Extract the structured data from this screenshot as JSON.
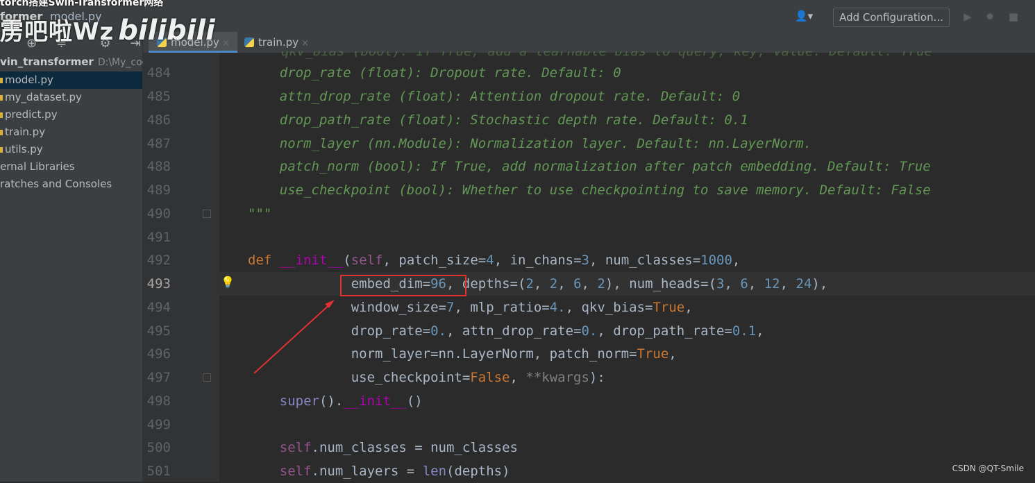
{
  "overlay": {
    "video_title": "torch搭建Swin-Transformer网络",
    "watermark_text": "雳吧啦Wz",
    "watermark_logo": "bilibili",
    "credit": "CSDN @QT-Smile"
  },
  "navbar": {
    "project_crumb": "former",
    "file_crumb": "model.py",
    "add_configuration": "Add Configuration...",
    "user_icon": "user-icon",
    "run_icon": "▶",
    "debug_icon": "✹",
    "stop_icon": "■"
  },
  "sidebar": {
    "tools": [
      "⊕",
      "≑",
      "⚙",
      "⇥"
    ],
    "root": {
      "name": "vin_transformer",
      "path": "D:\\My_code"
    },
    "items": [
      {
        "label": "model.py",
        "selected": true
      },
      {
        "label": "my_dataset.py",
        "selected": false
      },
      {
        "label": "predict.py",
        "selected": false
      },
      {
        "label": "train.py",
        "selected": false
      },
      {
        "label": "utils.py",
        "selected": false
      },
      {
        "label": "ernal Libraries",
        "selected": false
      },
      {
        "label": "ratches and Consoles",
        "selected": false
      }
    ]
  },
  "tabs": [
    {
      "label": "model.py",
      "active": true,
      "close": "×"
    },
    {
      "label": "train.py",
      "active": false,
      "close": "×"
    }
  ],
  "editor": {
    "cropped_line": "qkv_bias (bool): If True, add a learnable bias to query, key, value. Default: True",
    "lines": [
      {
        "num": "484",
        "text": "    drop_rate (float): Dropout rate. Default: 0"
      },
      {
        "num": "485",
        "text": "    attn_drop_rate (float): Attention dropout rate. Default: 0"
      },
      {
        "num": "486",
        "text": "    drop_path_rate (float): Stochastic depth rate. Default: 0.1"
      },
      {
        "num": "487",
        "text": "    norm_layer (nn.Module): Normalization layer. Default: nn.LayerNorm."
      },
      {
        "num": "488",
        "text": "    patch_norm (bool): If True, add normalization after patch embedding. Default: True"
      },
      {
        "num": "489",
        "text": "    use_checkpoint (bool): Whether to use checkpointing to save memory. Default: False"
      },
      {
        "num": "490",
        "text": "\"\"\""
      },
      {
        "num": "491",
        "text": ""
      },
      {
        "num": "492",
        "text": "def __init__(self, patch_size=4, in_chans=3, num_classes=1000,"
      },
      {
        "num": "493",
        "text": "             embed_dim=96, depths=(2, 2, 6, 2), num_heads=(3, 6, 12, 24),"
      },
      {
        "num": "494",
        "text": "             window_size=7, mlp_ratio=4., qkv_bias=True,"
      },
      {
        "num": "495",
        "text": "             drop_rate=0., attn_drop_rate=0., drop_path_rate=0.1,"
      },
      {
        "num": "496",
        "text": "             norm_layer=nn.LayerNorm, patch_norm=True,"
      },
      {
        "num": "497",
        "text": "             use_checkpoint=False, **kwargs):"
      },
      {
        "num": "498",
        "text": "    super().__init__()"
      },
      {
        "num": "499",
        "text": ""
      },
      {
        "num": "500",
        "text": "    self.num_classes = num_classes"
      },
      {
        "num": "501",
        "text": "    self.num_layers = len(depths)"
      }
    ],
    "current_line": "493",
    "highlighted_param": "embed_dim=96"
  },
  "colors": {
    "editor_bg": "#2b2b2b",
    "docstring": "#629755",
    "keyword": "#cc7832",
    "number": "#6897bb",
    "highlight_box": "#e33131"
  }
}
